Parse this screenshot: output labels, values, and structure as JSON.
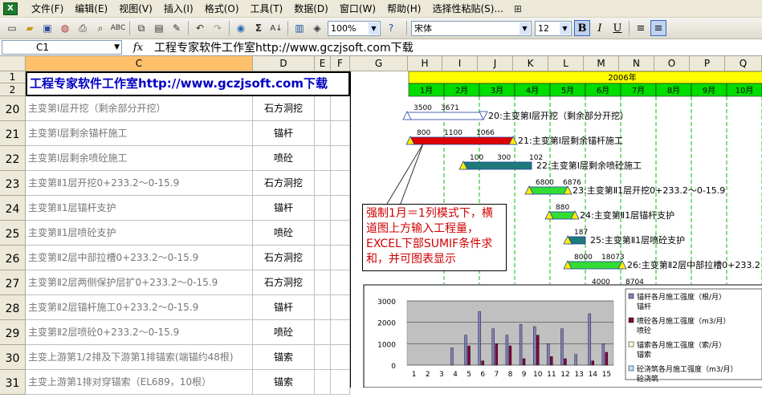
{
  "menu": [
    "文件(F)",
    "编辑(E)",
    "视图(V)",
    "插入(I)",
    "格式(O)",
    "工具(T)",
    "数据(D)",
    "窗口(W)",
    "帮助(H)",
    "选择性粘贴(S)..."
  ],
  "toolbar": {
    "zoom": "100%",
    "font": "宋体",
    "size": "12",
    "bold": "B",
    "italic": "I",
    "underline": "U"
  },
  "formula_bar": {
    "name_box": "C1",
    "fx": "fx",
    "content": "工程专家软件工作室http://www.gczjsoft.com下载"
  },
  "columns_left": [
    {
      "label": "C",
      "w": 0
    },
    {
      "label": "D"
    },
    {
      "label": "E"
    },
    {
      "label": "F"
    }
  ],
  "col_labels": [
    "C",
    "D",
    "E",
    "F",
    "G",
    "H",
    "I",
    "J",
    "K",
    "L",
    "M",
    "N",
    "O",
    "P",
    "Q"
  ],
  "header_rows": [
    "1",
    "2"
  ],
  "title_text": "工程专家软件工作室http://www.gczjsoft.com下载",
  "year_label": "2006年",
  "months": [
    "1月",
    "2月",
    "3月",
    "4月",
    "5月",
    "6月",
    "7月",
    "8月",
    "9月",
    "10月"
  ],
  "rows": [
    {
      "num": "20",
      "c": "主变第Ⅰ层开挖（剩余部分开挖）",
      "d": "石方洞挖"
    },
    {
      "num": "21",
      "c": "主变第Ⅰ层剩余锚杆施工",
      "d": "锚杆"
    },
    {
      "num": "22",
      "c": "主变第Ⅰ层剩余喷砼施工",
      "d": "喷砼"
    },
    {
      "num": "23",
      "c": "主变第Ⅱ1层开挖0+233.2～0-15.9",
      "d": "石方洞挖"
    },
    {
      "num": "24",
      "c": "主变第Ⅱ1层锚杆支护",
      "d": "锚杆"
    },
    {
      "num": "25",
      "c": "主变第Ⅱ1层喷砼支护",
      "d": "喷砼"
    },
    {
      "num": "26",
      "c": "主变第Ⅱ2层中部拉槽0+233.2～0-15.9",
      "d": "石方洞挖"
    },
    {
      "num": "27",
      "c": "主变第Ⅱ2层两侧保护层扩0+233.2～0-15.9",
      "d": "石方洞挖"
    },
    {
      "num": "28",
      "c": "主变第Ⅱ2层锚杆施工0+233.2～0-15.9",
      "d": "锚杆"
    },
    {
      "num": "29",
      "c": "主变第Ⅱ2层喷砼0+233.2～0-15.9",
      "d": "喷砼"
    },
    {
      "num": "30",
      "c": "主变上游第1/2排及下游第1排锚索(端锚约48根)",
      "d": "锚索"
    },
    {
      "num": "31",
      "c": "主变上游第1排对穿锚索（EL689，10根）",
      "d": "锚索"
    }
  ],
  "bars": [
    {
      "label": "20:主变第Ⅰ层开挖（剩余部分开挖）",
      "v1": "3500",
      "v2": "3671",
      "color": "#ffffff"
    },
    {
      "label": "21:主变第Ⅰ层剩余锚杆施工",
      "v1": "800",
      "v2": "1100",
      "v3": "1066",
      "color": "#e00000"
    },
    {
      "label": "22:主变第Ⅰ层剩余喷砼施工",
      "v1": "100",
      "v2": "300",
      "v3": "102",
      "color": "#1f7a7a"
    },
    {
      "label": "23:主变第Ⅱ1层开挖0+233.2～0-15.9",
      "v1": "6800",
      "v2": "6876",
      "color": "#33dd33"
    },
    {
      "label": "24:主变第Ⅱ1层锚杆支护",
      "v1": "880",
      "color": "#33dd33"
    },
    {
      "label": "25:主变第Ⅱ1层喷砼支护",
      "v1": "187",
      "color": "#1f7a7a"
    },
    {
      "label": "26:主变第Ⅱ2层中部拉槽0+233.2",
      "v1": "8000",
      "v2": "18073",
      "color": "#33dd33"
    },
    {
      "label": "",
      "v1": "4000",
      "v2": "8704",
      "color": "#33dd33"
    }
  ],
  "callout": "强制1月＝1列模式下，横道图上方输入工程量，EXCEL下部SUMIF条件求和，并可图表显示",
  "chart_data": {
    "type": "bar",
    "x": [
      1,
      2,
      3,
      4,
      5,
      6,
      7,
      8,
      9,
      10,
      11,
      12,
      13,
      14,
      15
    ],
    "ylim": [
      0,
      3000
    ],
    "yticks": [
      "3000",
      "2000",
      "1000",
      "0"
    ],
    "series": [
      {
        "name": "锚杆各月施工强度（根/月）锚杆",
        "color": "#8080c0",
        "values": [
          0,
          0,
          0,
          800,
          1400,
          2500,
          1700,
          1400,
          1900,
          1800,
          1000,
          1700,
          500,
          2400,
          1000
        ]
      },
      {
        "name": "喷砼各月施工强度（m3/月）喷砼",
        "color": "#800040",
        "values": [
          0,
          0,
          0,
          0,
          900,
          200,
          1000,
          900,
          300,
          1400,
          400,
          300,
          0,
          200,
          600
        ]
      },
      {
        "name": "锚索各月施工强度（索/月）锚索",
        "color": "#ffffe0",
        "values": [
          0,
          0,
          0,
          0,
          0,
          0,
          0,
          0,
          0,
          0,
          0,
          0,
          0,
          0,
          0
        ]
      },
      {
        "name": "砼浇筑各月施工强度（m3/月）砼浇筑",
        "color": "#c0e0ff",
        "values": [
          0,
          0,
          0,
          0,
          0,
          0,
          0,
          0,
          0,
          0,
          0,
          0,
          0,
          0,
          0
        ]
      }
    ],
    "legend": "right"
  }
}
